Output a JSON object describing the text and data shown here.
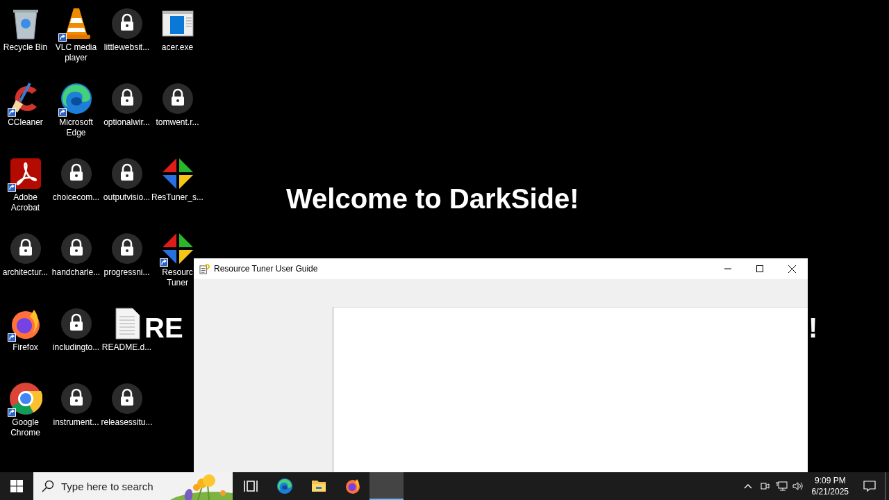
{
  "wallpaper": {
    "texts": [
      {
        "text": "Welcome to DarkSide!",
        "kind": "heading"
      },
      {
        "text": "RE",
        "kind": "left"
      },
      {
        "text": "!",
        "kind": "right"
      }
    ]
  },
  "desktop_icons": [
    {
      "label": "Recycle Bin",
      "kind": "recycle",
      "shortcut": false
    },
    {
      "label": "CCleaner",
      "kind": "broom",
      "shortcut": true
    },
    {
      "label": "Adobe Acrobat",
      "kind": "pdf",
      "shortcut": true
    },
    {
      "label": "architectur...",
      "kind": "lock",
      "shortcut": false
    },
    {
      "label": "Firefox",
      "kind": "fox",
      "shortcut": true
    },
    {
      "label": "Google Chrome",
      "kind": "chrome",
      "shortcut": true
    },
    {
      "label": "VLC media player",
      "kind": "cone",
      "shortcut": true
    },
    {
      "label": "Microsoft Edge",
      "kind": "swirl",
      "shortcut": true
    },
    {
      "label": "choicecom...",
      "kind": "lock",
      "shortcut": false
    },
    {
      "label": "handcharle...",
      "kind": "lock",
      "shortcut": false
    },
    {
      "label": "includingto...",
      "kind": "lock",
      "shortcut": false
    },
    {
      "label": "instrument...",
      "kind": "lock",
      "shortcut": false
    },
    {
      "label": "littlewebsit...",
      "kind": "lock",
      "shortcut": false
    },
    {
      "label": "optionalwir...",
      "kind": "lock",
      "shortcut": false
    },
    {
      "label": "outputvisio...",
      "kind": "lock",
      "shortcut": false
    },
    {
      "label": "progressni...",
      "kind": "lock",
      "shortcut": false
    },
    {
      "label": "README.d...",
      "kind": "document",
      "shortcut": false
    },
    {
      "label": "releasessitu...",
      "kind": "lock",
      "shortcut": false
    },
    {
      "label": "acer.exe",
      "kind": "window",
      "shortcut": false
    },
    {
      "label": "tomwent.r...",
      "kind": "lock",
      "shortcut": false
    },
    {
      "label": "ResTuner_s...",
      "kind": "diamond",
      "shortcut": false
    },
    {
      "label": "Resourc Tuner",
      "kind": "diamond",
      "shortcut": true
    }
  ],
  "window": {
    "title": "Resource Tuner User Guide"
  },
  "taskbar": {
    "search": {
      "placeholder": "Type here to search"
    },
    "apps": [
      {
        "kind": "taskview"
      },
      {
        "kind": "swirl"
      },
      {
        "kind": "folder"
      },
      {
        "kind": "fox"
      },
      {
        "kind": "blank"
      }
    ],
    "clock": {
      "time": "9:09 PM",
      "date": "6/21/2025"
    }
  }
}
